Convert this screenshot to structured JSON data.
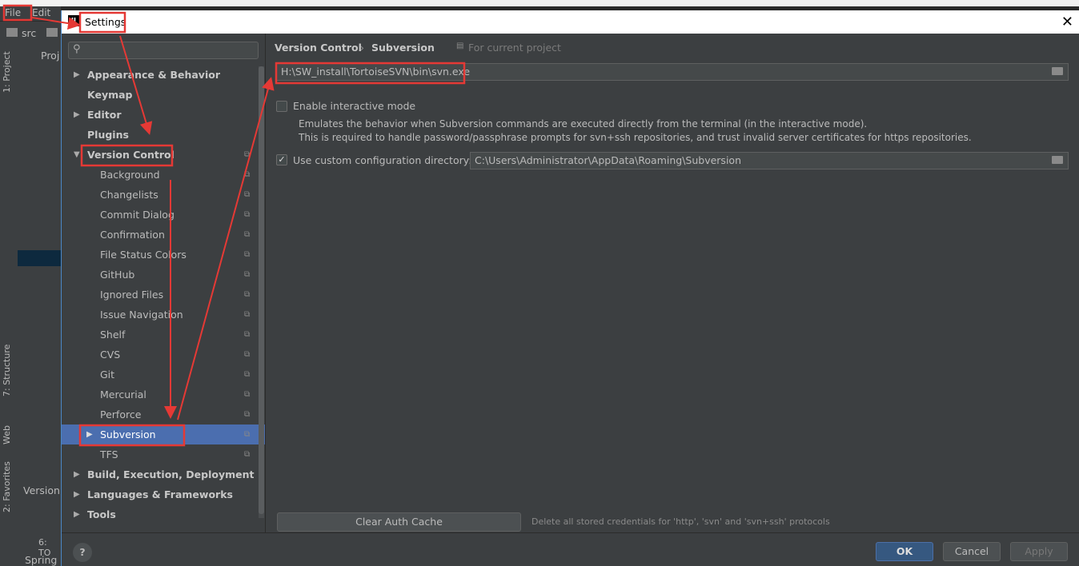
{
  "ide": {
    "menu": [
      "File",
      "Edit"
    ],
    "breadcrumb": "src",
    "project_tab": "Proj",
    "left_tabs": [
      "1: Project",
      "7: Structure",
      "Web",
      "2: Favorites"
    ],
    "bottom": [
      "6: TO",
      "Spring"
    ],
    "version_tab": "Version"
  },
  "dialog": {
    "title": "Settings",
    "search_placeholder": "",
    "tree": [
      {
        "label": "Appearance & Behavior",
        "level": 0,
        "bold": true,
        "arrow": "right"
      },
      {
        "label": "Keymap",
        "level": 0,
        "bold": true
      },
      {
        "label": "Editor",
        "level": 0,
        "bold": true,
        "arrow": "right"
      },
      {
        "label": "Plugins",
        "level": 0,
        "bold": true
      },
      {
        "label": "Version Control",
        "level": 0,
        "bold": true,
        "arrow": "down",
        "copy": true
      },
      {
        "label": "Background",
        "level": 1,
        "copy": true
      },
      {
        "label": "Changelists",
        "level": 1,
        "copy": true
      },
      {
        "label": "Commit Dialog",
        "level": 1,
        "copy": true
      },
      {
        "label": "Confirmation",
        "level": 1,
        "copy": true
      },
      {
        "label": "File Status Colors",
        "level": 1,
        "copy": true
      },
      {
        "label": "GitHub",
        "level": 1,
        "copy": true
      },
      {
        "label": "Ignored Files",
        "level": 1,
        "copy": true
      },
      {
        "label": "Issue Navigation",
        "level": 1,
        "copy": true
      },
      {
        "label": "Shelf",
        "level": 1,
        "copy": true
      },
      {
        "label": "CVS",
        "level": 1,
        "copy": true
      },
      {
        "label": "Git",
        "level": 1,
        "copy": true
      },
      {
        "label": "Mercurial",
        "level": 1,
        "copy": true
      },
      {
        "label": "Perforce",
        "level": 1,
        "copy": true
      },
      {
        "label": "Subversion",
        "level": 1,
        "copy": true,
        "arrow": "right",
        "selected": true
      },
      {
        "label": "TFS",
        "level": 1,
        "copy": true
      },
      {
        "label": "Build, Execution, Deployment",
        "level": 0,
        "bold": true,
        "arrow": "right"
      },
      {
        "label": "Languages & Frameworks",
        "level": 0,
        "bold": true,
        "arrow": "right"
      },
      {
        "label": "Tools",
        "level": 0,
        "bold": true,
        "arrow": "right"
      }
    ],
    "breadcrumb": {
      "parent": "Version Control",
      "current": "Subversion",
      "scope": "For current project"
    },
    "svn_path": "H:\\SW_install\\TortoiseSVN\\bin\\svn.exe",
    "interactive": {
      "label": "Enable interactive mode",
      "checked": false,
      "desc1": "Emulates the behavior when Subversion commands are executed directly from the terminal (in the interactive mode).",
      "desc2": "This is required to handle password/passphrase prompts for svn+ssh repositories, and trust invalid server certificates for https repositories."
    },
    "custom_dir": {
      "label": "Use custom configuration directory:",
      "checked": true,
      "value": "C:\\Users\\Administrator\\AppData\\Roaming\\Subversion"
    },
    "clear_cache": {
      "label": "Clear Auth Cache",
      "desc": "Delete all stored credentials for 'http', 'svn' and 'svn+ssh' protocols"
    },
    "buttons": {
      "ok": "OK",
      "cancel": "Cancel",
      "apply": "Apply",
      "help": "?"
    }
  },
  "colors": {
    "selection": "#4b6eaf",
    "annotation": "#e53935",
    "ok_button": "#365880"
  }
}
